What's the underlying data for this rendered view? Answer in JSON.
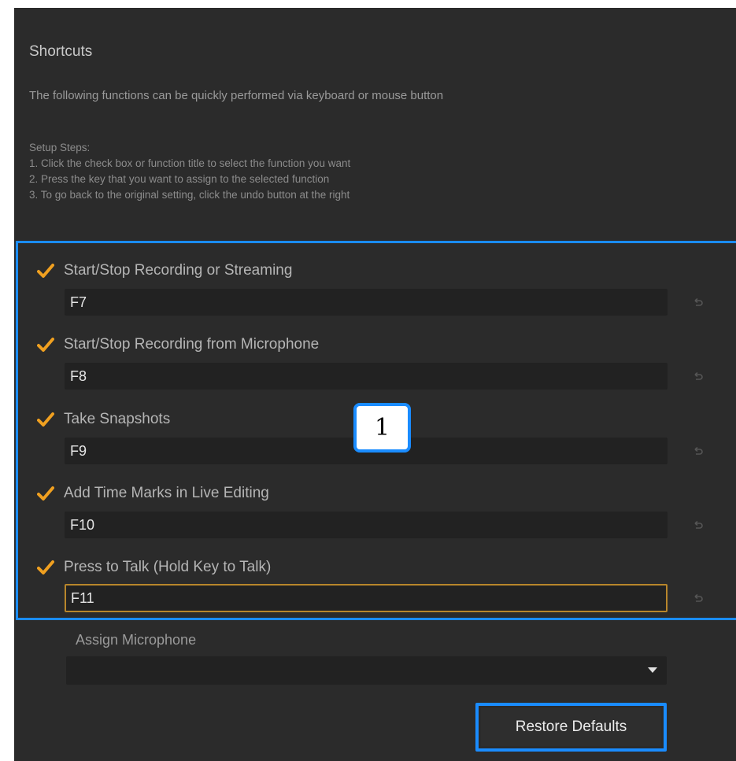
{
  "title": "Shortcuts",
  "intro": "The following functions can be quickly performed via keyboard or mouse button",
  "setup": {
    "heading": "Setup Steps:",
    "steps": [
      "1. Click the check box or function title to select the function you want",
      "2.  Press the key that you want to assign to the selected function",
      "3. To go back to the original setting, click the undo button at the right"
    ]
  },
  "shortcuts": [
    {
      "label": "Start/Stop Recording or Streaming",
      "key": "F7",
      "checked": true
    },
    {
      "label": "Start/Stop Recording from Microphone",
      "key": "F8",
      "checked": true
    },
    {
      "label": "Take Snapshots",
      "key": "F9",
      "checked": true
    },
    {
      "label": "Add Time Marks in Live Editing",
      "key": "F10",
      "checked": true
    },
    {
      "label": "Press to Talk (Hold Key to Talk)",
      "key": "F11",
      "checked": true
    }
  ],
  "callout": "1",
  "microphone": {
    "label": "Assign Microphone",
    "value": ""
  },
  "restore_label": "Restore Defaults",
  "colors": {
    "accent": "#1a8cff",
    "check": "#f0a020",
    "panel": "#2b2b2b",
    "field": "#222222"
  }
}
